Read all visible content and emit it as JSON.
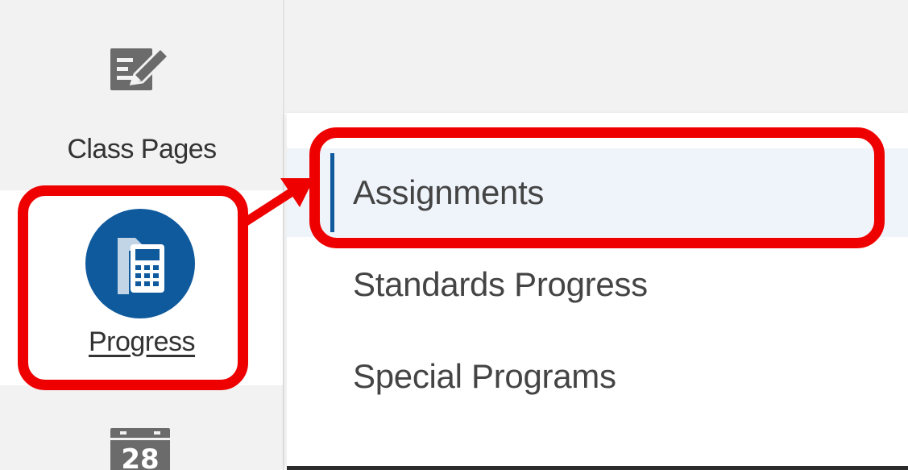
{
  "sidebar": {
    "items": [
      {
        "label": "Class Pages",
        "icon": "edit-icon"
      },
      {
        "label": "Progress",
        "icon": "calculator-icon"
      },
      {
        "label": "",
        "icon": "calendar-icon",
        "calendar_day": "28"
      }
    ]
  },
  "flyout": {
    "items": [
      {
        "label": "Assignments",
        "active": true
      },
      {
        "label": "Standards Progress",
        "active": false
      },
      {
        "label": "Special Programs",
        "active": false
      }
    ]
  },
  "colors": {
    "brand_blue": "#0f5a9c",
    "icon_gray": "#6b6b6b",
    "annotation_red": "#ee0000",
    "active_bg": "#eef4fa"
  }
}
